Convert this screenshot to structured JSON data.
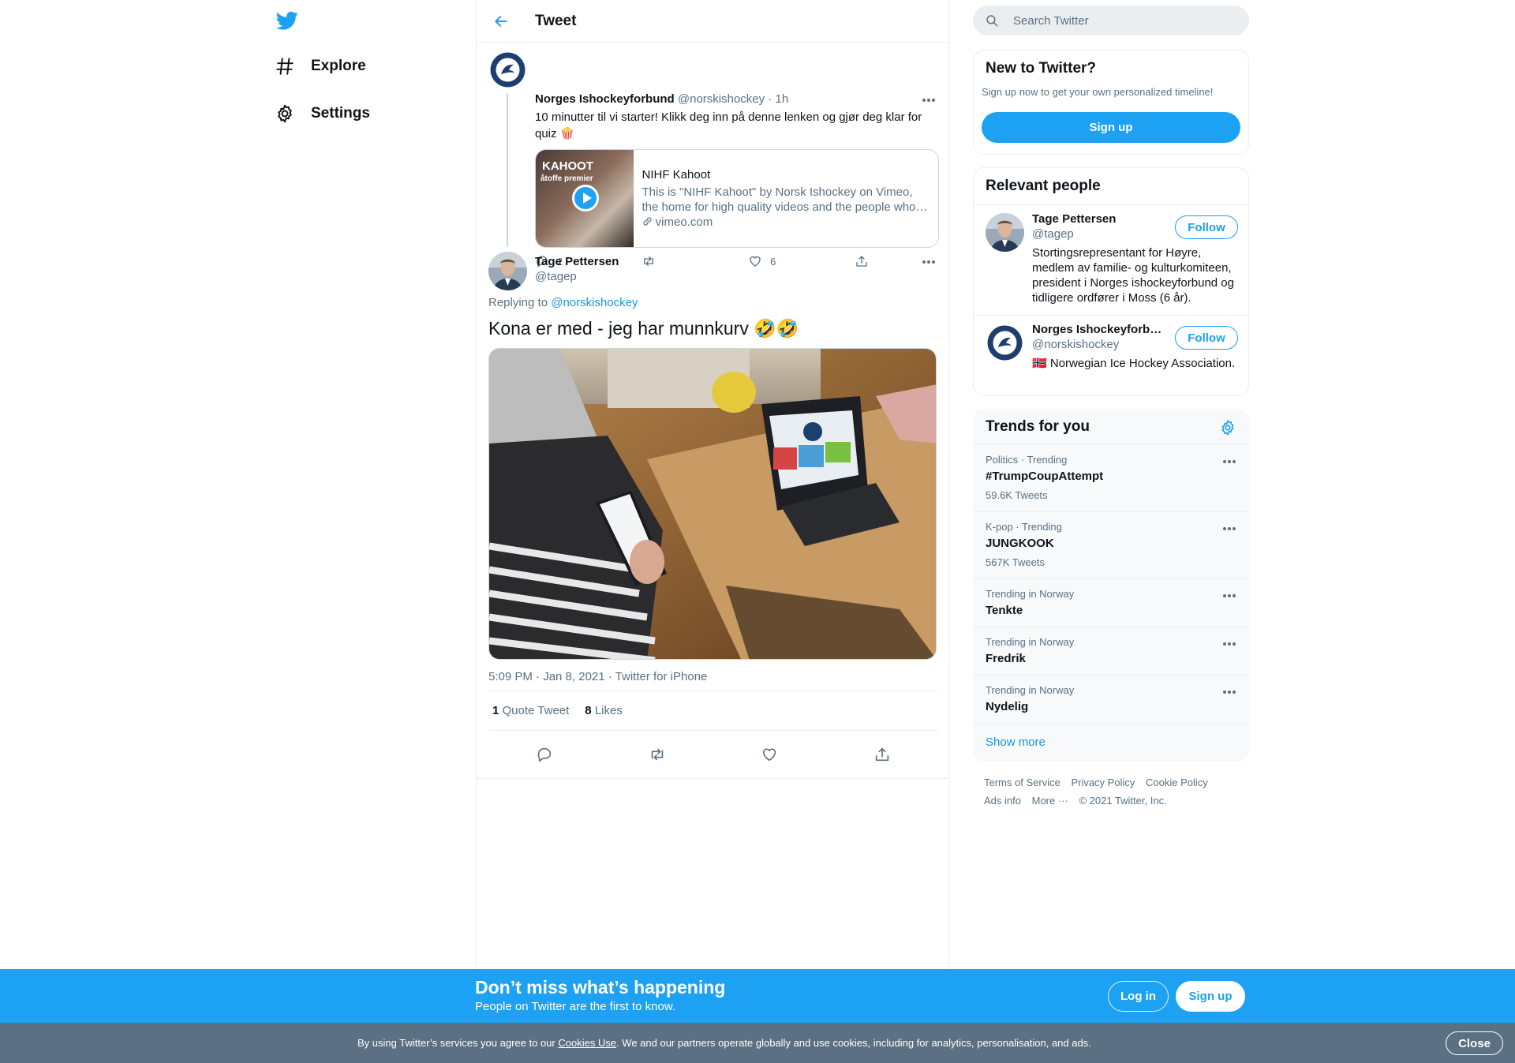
{
  "nav": {
    "items": [
      {
        "label": "Explore",
        "icon": "hashtag-icon"
      },
      {
        "label": "Settings",
        "icon": "gear-icon"
      }
    ]
  },
  "header": {
    "title": "Tweet"
  },
  "parent_tweet": {
    "name": "Norges Ishockeyforbund",
    "handle": "@norskishockey",
    "time": "1h",
    "text": "10 minutter til vi starter! Klikk deg inn på denne lenken og gjør deg klar for quiz 🍿",
    "card": {
      "thumb_title": "KAHOOT",
      "thumb_subtitle": "åtoffe premier",
      "title": "NIHF Kahoot",
      "description": "This is \"NIHF Kahoot\" by Norsk Ishockey on Vimeo, the home for high quality videos and the people who…",
      "domain": "vimeo.com"
    },
    "replies": "2",
    "retweets": "",
    "likes": "6"
  },
  "focus_tweet": {
    "name": "Tage Pettersen",
    "handle": "@tagep",
    "replying_prefix": "Replying to",
    "replying_to": "@norskishockey",
    "text": "Kona er med - jeg har munnkurv 🤣🤣",
    "timestamp": "5:09 PM · Jan 8, 2021",
    "source": "Twitter for iPhone",
    "quote_count": "1",
    "quote_label": "Quote Tweet",
    "like_count": "8",
    "like_label": "Likes"
  },
  "search": {
    "placeholder": "Search Twitter"
  },
  "new_to_twitter": {
    "title": "New to Twitter?",
    "subtitle": "Sign up now to get your own personalized timeline!",
    "button": "Sign up"
  },
  "relevant_people": {
    "title": "Relevant people",
    "people": [
      {
        "name": "Tage Pettersen",
        "handle": "@tagep",
        "bio": "Stortingsrepresentant for Høyre, medlem av familie- og kulturkomiteen, president i Norges ishockeyforbund og tidligere ordfører i Moss (6 år).",
        "button": "Follow"
      },
      {
        "name": "Norges Ishockeyforbund",
        "handle": "@norskishockey",
        "bio": "🇳🇴 Norwegian Ice Hockey Association.",
        "button": "Follow"
      }
    ]
  },
  "trends": {
    "title": "Trends for you",
    "items": [
      {
        "context": "Politics · Trending",
        "name": "#TrumpCoupAttempt",
        "count": "59.6K Tweets"
      },
      {
        "context": "K-pop · Trending",
        "name": "JUNGKOOK",
        "count": "567K Tweets"
      },
      {
        "context": "Trending in Norway",
        "name": "Tenkte",
        "count": ""
      },
      {
        "context": "Trending in Norway",
        "name": "Fredrik",
        "count": ""
      },
      {
        "context": "Trending in Norway",
        "name": "Nydelig",
        "count": ""
      }
    ],
    "show_more": "Show more"
  },
  "footer": {
    "links": [
      "Terms of Service",
      "Privacy Policy",
      "Cookie Policy",
      "Ads info",
      "More ···"
    ],
    "copyright": "© 2021 Twitter, Inc."
  },
  "banner": {
    "title": "Don’t miss what’s happening",
    "subtitle": "People on Twitter are the first to know.",
    "login": "Log in",
    "signup": "Sign up"
  },
  "cookie": {
    "prefix": "By using Twitter’s services you agree to our ",
    "link": "Cookies Use",
    "suffix": ". We and our partners operate globally and use cookies, including for analytics, personalisation, and ads.",
    "close": "Close"
  },
  "colors": {
    "accent": "#1da1f2",
    "muted": "#5b7083",
    "cookie_bar": "#5b7083"
  }
}
